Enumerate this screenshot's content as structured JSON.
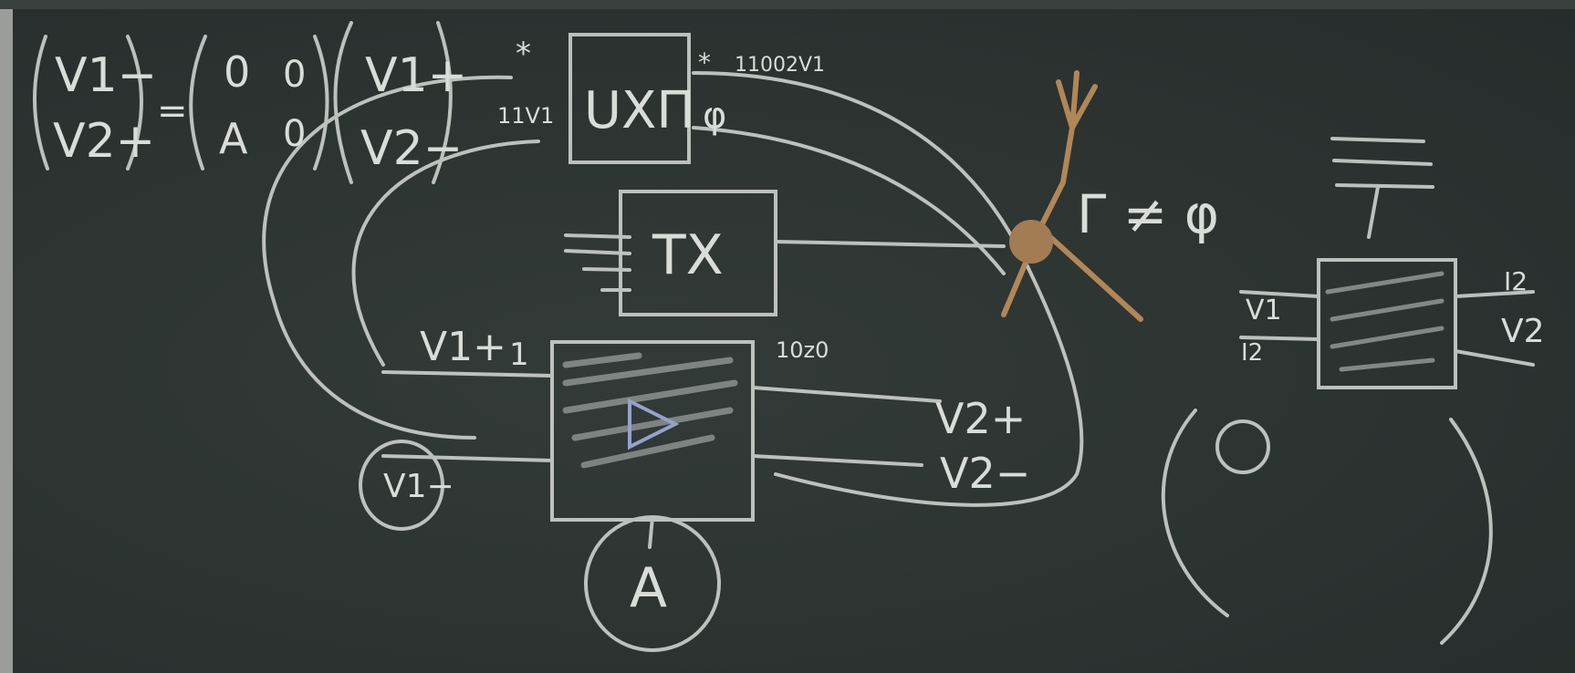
{
  "board": {
    "matrix_equation": {
      "lhs": [
        "V1−",
        "V2+"
      ],
      "equals": "=",
      "matrix": [
        [
          "0",
          "0"
        ],
        [
          "A",
          "0"
        ]
      ],
      "rhs": [
        "V1+",
        "V2−"
      ]
    },
    "top_box": {
      "label": "UXΠ",
      "left_note": "11V1",
      "right_note": "11002V1",
      "right_symbol": "φ",
      "marks": [
        "*",
        "*"
      ]
    },
    "middle_box": {
      "label": "TX"
    },
    "amp_box": {
      "circle_label": "A"
    },
    "port_labels": {
      "v1_plus": "V1+",
      "v1_plus_mark": "1",
      "v1_minus": "V1−",
      "v2_plus": "V2+",
      "v2_minus": "V2−",
      "note_right": "10z0"
    },
    "gamma_note": "Γ ≠ φ",
    "right_box": {
      "v1": "V1",
      "i2": "I2",
      "v2": "V2",
      "i_top": "I2"
    }
  },
  "colors": {
    "board": "#2c3331",
    "chalk": "#d9ddd8",
    "tape": "#b8895a"
  }
}
